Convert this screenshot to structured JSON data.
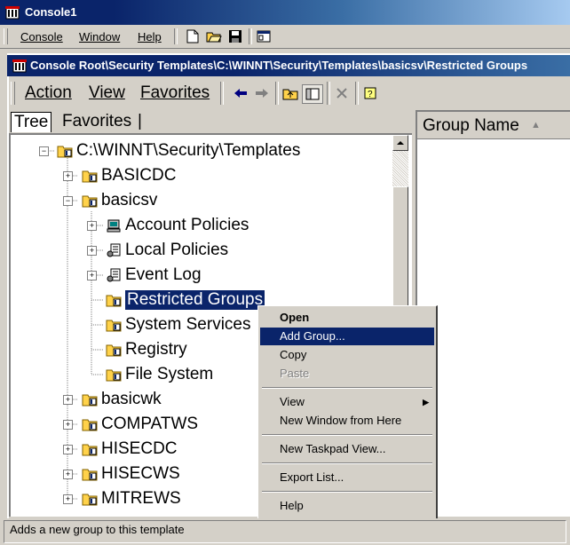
{
  "window": {
    "title": "Console1"
  },
  "menubar": {
    "items": [
      {
        "label": "Console"
      },
      {
        "label": "Window"
      },
      {
        "label": "Help"
      }
    ]
  },
  "child_window": {
    "title": "Console Root\\Security Templates\\C:\\WINNT\\Security\\Templates\\basicsv\\Restricted Groups"
  },
  "actionbar": {
    "items": [
      {
        "label": "Action"
      },
      {
        "label": "View"
      },
      {
        "label": "Favorites"
      }
    ]
  },
  "tabs": [
    {
      "label": "Tree",
      "active": true
    },
    {
      "label": "Favorites",
      "active": false
    }
  ],
  "tree": {
    "root": "C:\\WINNT\\Security\\Templates",
    "items": [
      {
        "label": "BASICDC",
        "expander": "+"
      },
      {
        "label": "basicsv",
        "expander": "-"
      },
      {
        "label": "Account Policies",
        "expander": "+",
        "icon": "policy-icon"
      },
      {
        "label": "Local Policies",
        "expander": "+",
        "icon": "policy-icon"
      },
      {
        "label": "Event Log",
        "expander": "+",
        "icon": "policy-icon"
      },
      {
        "label": "Restricted Groups",
        "icon": "folder-icon",
        "selected": true
      },
      {
        "label": "System Services",
        "icon": "folder-icon"
      },
      {
        "label": "Registry",
        "icon": "folder-icon"
      },
      {
        "label": "File System",
        "icon": "folder-icon"
      },
      {
        "label": "basicwk",
        "expander": "+"
      },
      {
        "label": "COMPATWS",
        "expander": "+"
      },
      {
        "label": "HISECDC",
        "expander": "+"
      },
      {
        "label": "HISECWS",
        "expander": "+"
      },
      {
        "label": "MITREWS",
        "expander": "+"
      }
    ]
  },
  "listpane": {
    "column_header": "Group Name"
  },
  "context_menu": {
    "items": [
      {
        "label": "Open"
      },
      {
        "label": "Add Group..."
      },
      {
        "label": "Copy"
      },
      {
        "label": "Paste"
      },
      {
        "label": "View"
      },
      {
        "label": "New Window from Here"
      },
      {
        "label": "New Taskpad View..."
      },
      {
        "label": "Export List..."
      },
      {
        "label": "Help"
      }
    ]
  },
  "statusbar": {
    "text": "Adds a new group to this template"
  },
  "colors": {
    "selection": "#0a246a",
    "face": "#d4d0c8"
  }
}
